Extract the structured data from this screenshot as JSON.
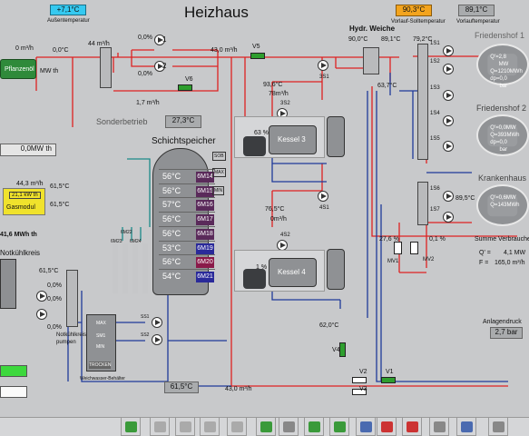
{
  "header": {
    "title": "Heizhaus",
    "outdoor_temp": "+7,1°C",
    "outdoor_label": "Außentemperatur",
    "supply_setpoint": "90,3°C",
    "supply_setpoint_label": "Vorlauf-Solltemperatur",
    "supply_temp": "89,1°C",
    "supply_temp_label": "Vorlauftemperatur"
  },
  "left": {
    "flow_top": "0 m³/h",
    "temp_top": "0,0°C",
    "pflanzenoel": "Pflanzenöl",
    "mw_label": "MW th",
    "mw_value": "0,0MW th",
    "power": "0,0MW th",
    "gas_flow": "44,3 m³/h",
    "gas_kw": "21,1 kW th",
    "gasmodul": "Gasmodul",
    "gas_t1": "61,5°C",
    "gas_t2": "61,5°C",
    "mwh": "41,6 MWh th",
    "cooling": "Notkühlkreis",
    "cool_t": "61,5°C",
    "cool_p1": "0,0%",
    "cool_p2": "0,0%",
    "cool_p3": "0,0%",
    "cool_pumps": "Notkühlkreis-\npumpen"
  },
  "center": {
    "flow1": "44 m³/h",
    "p1": "0,0%",
    "p2": "0,0%",
    "flow2": "1,7 m³/h",
    "v6": "V6",
    "sonder": "Sonderbetrieb",
    "sonder_temp": "27,3°C",
    "storage_title": "Schichtspeicher",
    "layers": [
      {
        "t": "56°C",
        "id": "6M14"
      },
      {
        "t": "56°C",
        "id": "6M15"
      },
      {
        "t": "57°C",
        "id": "6M16"
      },
      {
        "t": "56°C",
        "id": "6M17"
      },
      {
        "t": "56°C",
        "id": "6M18"
      },
      {
        "t": "53°C",
        "id": "6M19"
      },
      {
        "t": "56°C",
        "id": "6M20"
      },
      {
        "t": "54°C",
        "id": "6M21"
      }
    ],
    "sob": "SOB",
    "max": "MAX",
    "min": "MIN",
    "m22": "6M22",
    "m23": "6M23",
    "m24": "6M24",
    "bottom_temp": "61,5°C",
    "bottom_flow": "43,0 m³/h",
    "water_tank": "Weichwasser-Behälter",
    "wt_max": "MAX",
    "wt_sm": "SM1",
    "wt_min": "MIN",
    "wt_dry": "TROCKEN",
    "s1": "SS1",
    "s2": "SS2"
  },
  "boilers": {
    "flow_top": "43,0 m³/h",
    "v5": "V5",
    "k3_temp": "93,6°C",
    "k3_flow": "78m³/h",
    "k3_pump": "3S2",
    "k3_name": "Kessel 3",
    "k3_pct": "63 %",
    "k3_out": "3S1",
    "k4_temp": "76,5°C",
    "k4_flow": "0m³/h",
    "k4_pump": "4S2",
    "k4_name": "Kessel 4",
    "k4_pct": "1 %",
    "k4_out": "4S1",
    "bottom_t": "62,0°C",
    "v4": "V4",
    "v1": "V1",
    "v2": "V2",
    "v3": "V3"
  },
  "weiche": {
    "title": "Hydr. Weiche",
    "t1": "90,0°C",
    "t2": "89,1°C",
    "t3": "63,7°C",
    "t4": "79,2°C"
  },
  "distribution": {
    "pumps": [
      "1S1",
      "1S2",
      "1S3",
      "1S4",
      "1S5"
    ],
    "fs1_title": "Friedenshof 1",
    "fs1": {
      "q": "2,8 MW",
      "qs": "1210MWh",
      "dp": "0,0 bar"
    },
    "fs2_title": "Friedenshof 2",
    "fs2": {
      "q": "0,0MW",
      "qs": "393MWh",
      "dp": "0,0 bar"
    },
    "kh_title": "Krankenhaus",
    "kh_temp": "89,5°C",
    "kh": {
      "q": "0,6MW",
      "qs": "143MWh"
    },
    "kh_pumps": [
      "1S6",
      "1S7"
    ],
    "mv1": "MV1",
    "mv2": "MV2",
    "mv1_pct": "27,6 %",
    "mv2_pct": "0,1 %",
    "sum_title": "Summe Verbraucher",
    "sum_q": "4,1 MW",
    "sum_f": "165,0 m³/h",
    "pressure_label": "Anlagendruck",
    "pressure": "2,7 bar"
  },
  "toolbar": {
    "icons": [
      "home-icon",
      "back-icon",
      "up-icon",
      "down-icon",
      "forward-icon",
      "undo-icon",
      "redo-icon",
      "transfer-icon",
      "export-icon",
      "print-icon",
      "chart-icon",
      "pdf-icon",
      "monitor-icon",
      "eye-icon",
      "edit-icon"
    ]
  }
}
